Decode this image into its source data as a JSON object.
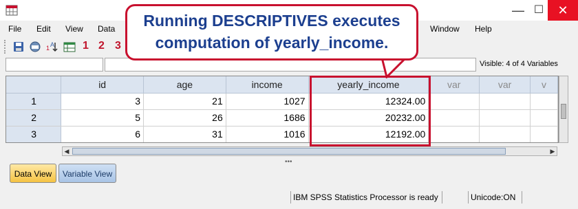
{
  "titlebar": {
    "minimize": "—",
    "maximize": "☐",
    "close": "✕"
  },
  "menubar": {
    "items": [
      "File",
      "Edit",
      "View",
      "Data",
      "Window",
      "Help"
    ]
  },
  "toolbar": {
    "nums": [
      "1",
      "2",
      "3"
    ]
  },
  "editor": {
    "visible_label": "Visible: 4 of 4 Variables"
  },
  "grid": {
    "columns": [
      "id",
      "age",
      "income",
      "yearly_income",
      "var",
      "var",
      "v"
    ],
    "rows": [
      {
        "num": "1",
        "cells": [
          "3",
          "21",
          "1027",
          "12324.00",
          "",
          "",
          ""
        ]
      },
      {
        "num": "2",
        "cells": [
          "5",
          "26",
          "1686",
          "20232.00",
          "",
          "",
          ""
        ]
      },
      {
        "num": "3",
        "cells": [
          "6",
          "31",
          "1016",
          "12192.00",
          "",
          "",
          ""
        ]
      }
    ]
  },
  "tabs": {
    "data_view": "Data View",
    "variable_view": "Variable View"
  },
  "statusbar": {
    "processor": "IBM SPSS Statistics Processor is ready",
    "unicode": "Unicode:ON"
  },
  "callout": {
    "line1": "Running DESCRIPTIVES executes",
    "line2": "computation of yearly_income."
  },
  "colors": {
    "accent": "#c8102e",
    "callout_text": "#1c3f8f",
    "header_bg": "#dbe4f0"
  }
}
